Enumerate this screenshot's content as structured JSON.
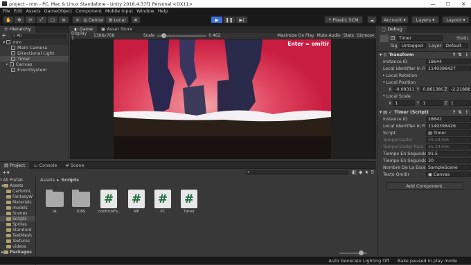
{
  "window": {
    "title": "project - mm - PC, Mac & Linux Standalone - Unity 2018.4.37f1 Personal <DX11>",
    "min": "—",
    "max": "☐",
    "close": "✕"
  },
  "menu": [
    "File",
    "Edit",
    "Assets",
    "GameObject",
    "Component",
    "Mobile Input",
    "Window",
    "Help"
  ],
  "toolbar": {
    "center": "Center",
    "local": "Local",
    "collab": "Plastic SCM",
    "account": "Account",
    "layers": "Layers",
    "layout": "Layout"
  },
  "hierarchy": {
    "tab": "Hierarchy",
    "create": "+",
    "search_placeholder": "All",
    "scene": "mm",
    "items": [
      "Main Camera",
      "Directional Light",
      "Timer",
      "Canvas",
      "EventSystem"
    ]
  },
  "game": {
    "tab_game": "Game",
    "tab_store": "Asset Store",
    "display": "Display 1",
    "resolution": "1366x768",
    "scale_label": "Scale",
    "scale_value": "0.462",
    "maximize": "Maximize On Play",
    "mute": "Mute Audio",
    "stats": "Stats",
    "gizmos": "Gizmos",
    "overlay_text": "Enter = omitir"
  },
  "project": {
    "tab_project": "Project",
    "tab_console": "Console",
    "tab_scene": "Scene",
    "breadcrumb_root": "Assets",
    "breadcrumb_sep": "▸",
    "breadcrumb_current": "Scripts",
    "tree_search": "All Prefab",
    "tree": [
      "Assets",
      "CartoonL",
      "FantasyW",
      "Materials",
      "models",
      "Scenes",
      "Scripts",
      "Sprites",
      "Standard",
      "TextMesh",
      "Textures",
      "videos",
      "Packages"
    ],
    "assets": [
      {
        "name": "IA",
        "kind": "folder"
      },
      {
        "name": "ICBS",
        "kind": "folder"
      },
      {
        "name": "controlsFa...",
        "kind": "script"
      },
      {
        "name": "MP",
        "kind": "script"
      },
      {
        "name": "PC",
        "kind": "script"
      },
      {
        "name": "Timer",
        "kind": "script"
      }
    ],
    "badge": "9"
  },
  "inspector": {
    "tab": "Inspector",
    "debug": "Debug",
    "object_name": "Timer",
    "static": "Static",
    "tag_label": "Tag",
    "tag": "Untagged",
    "layer_label": "Layer",
    "layer": "Default",
    "transform": {
      "title": "Transform",
      "instance_label": "Instance ID",
      "instance_id": "18644",
      "local_id_label": "Local Identifier In File",
      "local_id": "1149398427",
      "rotation_label": "Local Rotation",
      "position_label": "Local Position",
      "pos_x": "-0.093115",
      "pos_y": "0.8613897",
      "pos_z": "-2.218889",
      "scale_label": "Local Scale",
      "scale_x": "1",
      "scale_y": "1",
      "scale_z": "1"
    },
    "script": {
      "title": "Timer (Script)",
      "instance_label": "Instance ID",
      "instance_id": "18642",
      "local_id_label": "Local Identifier In File",
      "local_id": "1149398426",
      "script_label": "Script",
      "script": "Timer",
      "temp_label": "Temporizador",
      "temp": "35.24306",
      "temp_para_label": "Temporizador Para T",
      "temp_para": "35.24306",
      "tiempo_label": "Tiempo En Segundos",
      "tiempo": "91.5",
      "tiempo2_label": "Tiempo En Segundos",
      "tiempo2": "30",
      "nombre_label": "Nombre De La Escena",
      "nombre": "SampleScene",
      "texto_label": "Texto Omitir",
      "texto": "Canvas"
    },
    "add_component": "Add Component"
  },
  "status": {
    "lighting": "Auto Generate Lighting Off",
    "bake": "Bake paused in play mode"
  },
  "colors": {
    "accent": "#3a72d8",
    "game_bg": "#d8324a"
  }
}
